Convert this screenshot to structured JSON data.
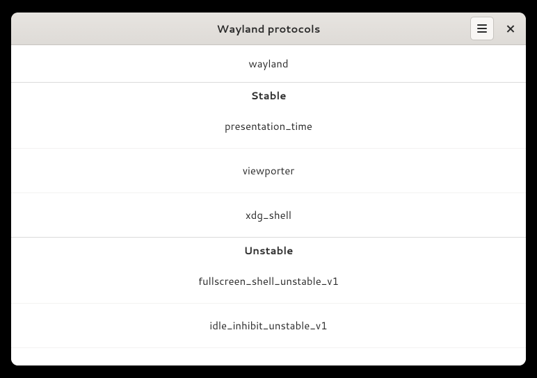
{
  "header": {
    "title": "Wayland protocols"
  },
  "core": {
    "items": [
      "wayland"
    ]
  },
  "sections": [
    {
      "title": "Stable",
      "items": [
        "presentation_time",
        "viewporter",
        "xdg_shell"
      ]
    },
    {
      "title": "Unstable",
      "items": [
        "fullscreen_shell_unstable_v1",
        "idle_inhibit_unstable_v1"
      ]
    }
  ]
}
